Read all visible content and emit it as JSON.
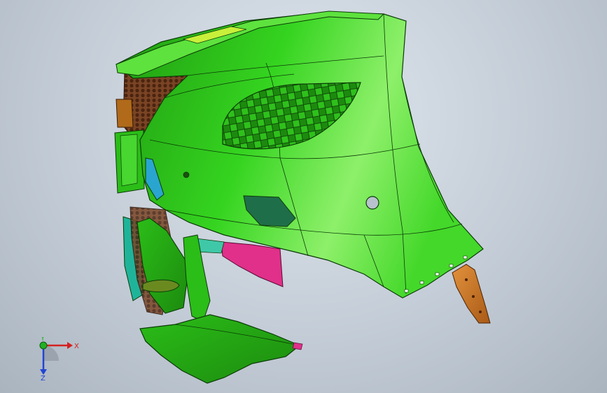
{
  "viewport": {
    "background_top": "#dfe6ee",
    "background_bottom": "#aab4bf"
  },
  "model": {
    "colors": {
      "body": "#33d21c",
      "body_light": "#8ef06a",
      "body_dark": "#1f9a10",
      "grille": "#6b3a1c",
      "brace": "#d2751d",
      "clip_pink": "#e0308a",
      "teal": "#1fb49a",
      "sensor_cover": "#1f6e4a",
      "reflector": "#2aa5d0",
      "edge": "#0c3b08"
    }
  },
  "triad": {
    "x_label": "X",
    "y_label": "Y",
    "z_label": "Z",
    "x_color": "#d42020",
    "y_color": "#22b022",
    "z_color": "#2244d4"
  }
}
